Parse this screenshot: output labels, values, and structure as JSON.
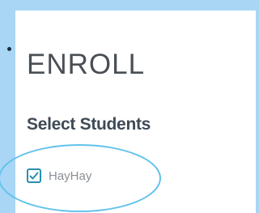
{
  "page": {
    "title": "ENROLL",
    "subtitle": "Select Students"
  },
  "students": [
    {
      "name": "HayHay",
      "checked": true
    }
  ],
  "colors": {
    "background": "#a9d6f5",
    "panel": "#ffffff",
    "accent": "#2a8fb0",
    "highlight_ring": "#62c2ec"
  },
  "icons": {
    "checkbox": "checkmark-icon"
  }
}
